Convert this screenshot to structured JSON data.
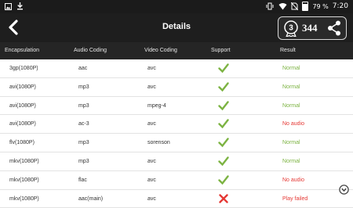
{
  "status_bar": {
    "battery": "79 %",
    "time": "7:20",
    "icons": [
      "image-icon",
      "download-icon",
      "vibrate-icon",
      "wifi-icon",
      "no-sim-icon",
      "battery-icon"
    ]
  },
  "topbar": {
    "title": "Details",
    "back_icon": "chevron-left-icon",
    "score_rank": "3",
    "score_value": "344",
    "share_icon": "share-icon"
  },
  "table": {
    "columns": [
      "Encapsulation",
      "Audio Coding",
      "Video Coding",
      "Support",
      "Result"
    ],
    "rows": [
      {
        "encap": "3gp(1080P)",
        "audio": "aac",
        "video": "avc",
        "support": "check-icon",
        "result": "Normal"
      },
      {
        "encap": "avi(1080P)",
        "audio": "mp3",
        "video": "avc",
        "support": "check-icon",
        "result": "Normal"
      },
      {
        "encap": "avi(1080P)",
        "audio": "mp3",
        "video": "mpeg-4",
        "support": "check-icon",
        "result": "Normal"
      },
      {
        "encap": "avi(1080P)",
        "audio": "ac-3",
        "video": "avc",
        "support": "check-icon",
        "result": "No audio"
      },
      {
        "encap": "flv(1080P)",
        "audio": "mp3",
        "video": "sorenson",
        "support": "check-icon",
        "result": "Normal"
      },
      {
        "encap": "mkv(1080P)",
        "audio": "mp3",
        "video": "avc",
        "support": "check-icon",
        "result": "Normal"
      },
      {
        "encap": "mkv(1080P)",
        "audio": "flac",
        "video": "avc",
        "support": "check-icon",
        "result": "No audio"
      },
      {
        "encap": "mkv(1080P)",
        "audio": "aac(main)",
        "video": "avc",
        "support": "cross-icon",
        "result": "Play failed"
      }
    ]
  },
  "colors": {
    "normal": "#7cb342",
    "problem": "#e53935",
    "check": "#7cb342",
    "cross": "#e53935"
  },
  "scroll_down_icon": "chevron-down-circle-icon"
}
